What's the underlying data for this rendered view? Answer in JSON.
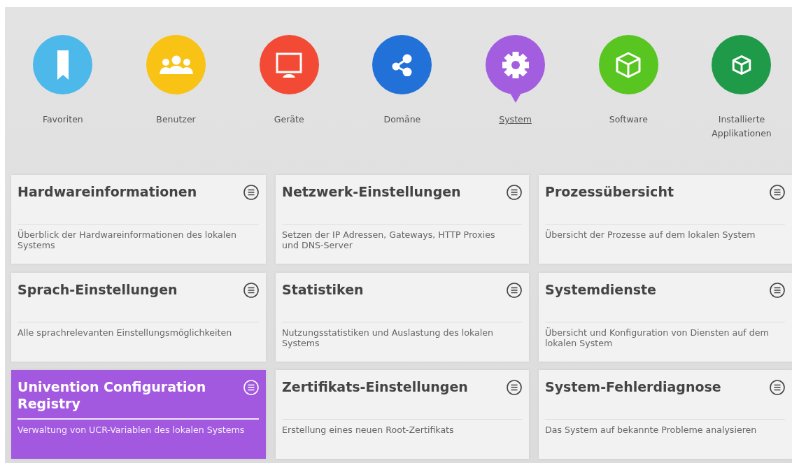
{
  "categories": [
    {
      "label": "Favoriten",
      "color": "#4db8ea",
      "selected": false
    },
    {
      "label": "Benutzer",
      "color": "#f8c315",
      "selected": false
    },
    {
      "label": "Geräte",
      "color": "#f24a35",
      "selected": false
    },
    {
      "label": "Domäne",
      "color": "#2271d8",
      "selected": false
    },
    {
      "label": "System",
      "color": "#a35ee0",
      "selected": true
    },
    {
      "label": "Software",
      "color": "#58c520",
      "selected": false
    },
    {
      "label": "Installierte Applikationen",
      "color": "#1f9a48",
      "selected": false
    }
  ],
  "modules": [
    {
      "title": "Hardwareinformationen",
      "description": "Überblick der Hardwareinformationen des lokalen Systems",
      "selected": false
    },
    {
      "title": "Netzwerk-Einstellungen",
      "description": "Setzen der IP Adressen, Gateways, HTTP Proxies und DNS-Server",
      "selected": false
    },
    {
      "title": "Prozessübersicht",
      "description": "Übersicht der Prozesse auf dem lokalen System",
      "selected": false
    },
    {
      "title": "Sprach-Einstellungen",
      "description": "Alle sprachrelevanten Einstellungsmöglichkeiten",
      "selected": false
    },
    {
      "title": "Statistiken",
      "description": "Nutzungsstatistiken und Auslastung des lokalen Systems",
      "selected": false
    },
    {
      "title": "Systemdienste",
      "description": "Übersicht und Konfiguration von Diensten auf dem lokalen System",
      "selected": false
    },
    {
      "title": "Univention Configuration Registry",
      "description": "Verwaltung von UCR-Variablen des lokalen Systems",
      "selected": true
    },
    {
      "title": "Zertifikats-Einstellungen",
      "description": "Erstellung eines neuen Root-Zertifikats",
      "selected": false
    },
    {
      "title": "System-Fehlerdiagnose",
      "description": "Das System auf bekannte Probleme analysieren",
      "selected": false
    }
  ]
}
